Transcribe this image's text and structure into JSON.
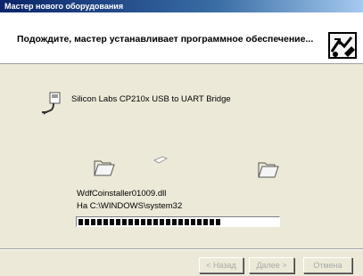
{
  "window": {
    "title": "Мастер нового оборудования"
  },
  "header": {
    "title": "Подождите, мастер устанавливает программное обеспечение..."
  },
  "device": {
    "name": "Silicon Labs CP210x USB to UART Bridge",
    "icon": "usb-plug-icon"
  },
  "copy": {
    "file_name": "WdfCoinstaller01009.dll",
    "destination": "На C:\\WINDOWS\\system32",
    "progress_percent": 70
  },
  "buttons": {
    "back": "< Назад",
    "next": "Далее >",
    "cancel": "Отмена"
  }
}
